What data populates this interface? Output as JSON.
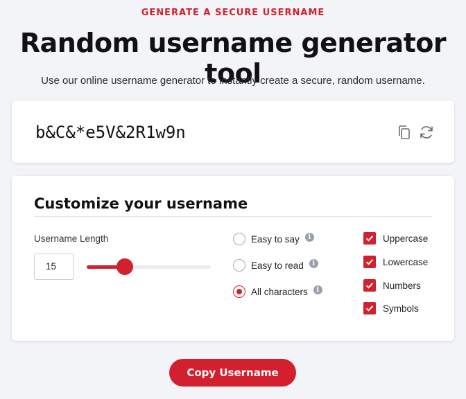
{
  "header": {
    "eyebrow": "GENERATE A SECURE USERNAME",
    "title": "Random username generator tool",
    "subtitle": "Use our online username generator to instantly create a secure, random username."
  },
  "output": {
    "username": "b&C&*e5V&2R1w9n",
    "copy_icon": "copy-icon",
    "refresh_icon": "refresh-icon"
  },
  "customize": {
    "heading": "Customize your username",
    "length_label": "Username Length",
    "length_value": "15",
    "slider_fraction": 0.31,
    "modes": [
      {
        "label": "Easy to say",
        "checked": false
      },
      {
        "label": "Easy to read",
        "checked": false
      },
      {
        "label": "All characters",
        "checked": true
      }
    ],
    "options": [
      {
        "label": "Uppercase",
        "checked": true
      },
      {
        "label": "Lowercase",
        "checked": true
      },
      {
        "label": "Numbers",
        "checked": true
      },
      {
        "label": "Symbols",
        "checked": true
      }
    ]
  },
  "actions": {
    "copy_label": "Copy Username"
  },
  "colors": {
    "accent": "#d2202f",
    "background": "#f3f4f7"
  }
}
